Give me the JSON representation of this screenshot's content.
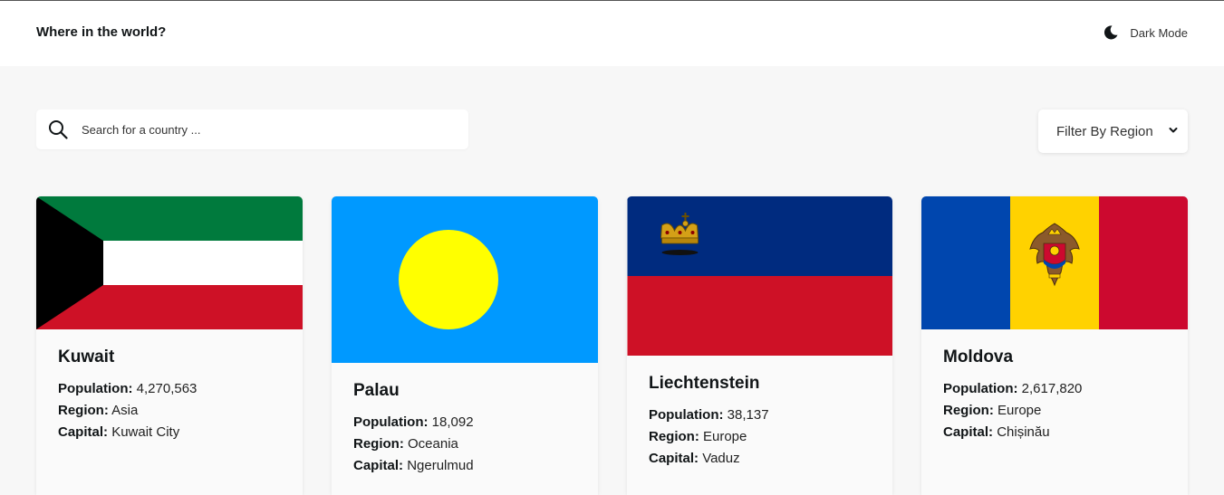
{
  "header": {
    "title": "Where in the world?",
    "mode_label": "Dark Mode"
  },
  "search": {
    "placeholder": "Search for a country ..."
  },
  "filter": {
    "selected": "Filter By Region"
  },
  "labels": {
    "population": "Population:",
    "region": "Region:",
    "capital": "Capital:"
  },
  "countries": [
    {
      "name": "Kuwait",
      "population": "4,270,563",
      "region": "Asia",
      "capital": "Kuwait City"
    },
    {
      "name": "Palau",
      "population": "18,092",
      "region": "Oceania",
      "capital": "Ngerulmud"
    },
    {
      "name": "Liechtenstein",
      "population": "38,137",
      "region": "Europe",
      "capital": "Vaduz"
    },
    {
      "name": "Moldova",
      "population": "2,617,820",
      "region": "Europe",
      "capital": "Chișinău"
    }
  ],
  "colors": {
    "kuwait_green": "#007a3d",
    "kuwait_red": "#ce1126",
    "palau_blue": "#0099ff",
    "palau_yellow": "#ffff00",
    "liechtenstein_blue": "#002b7f",
    "liechtenstein_red": "#ce1126",
    "moldova_blue": "#0046ae",
    "moldova_yellow": "#ffd200",
    "moldova_red": "#cc092f"
  }
}
